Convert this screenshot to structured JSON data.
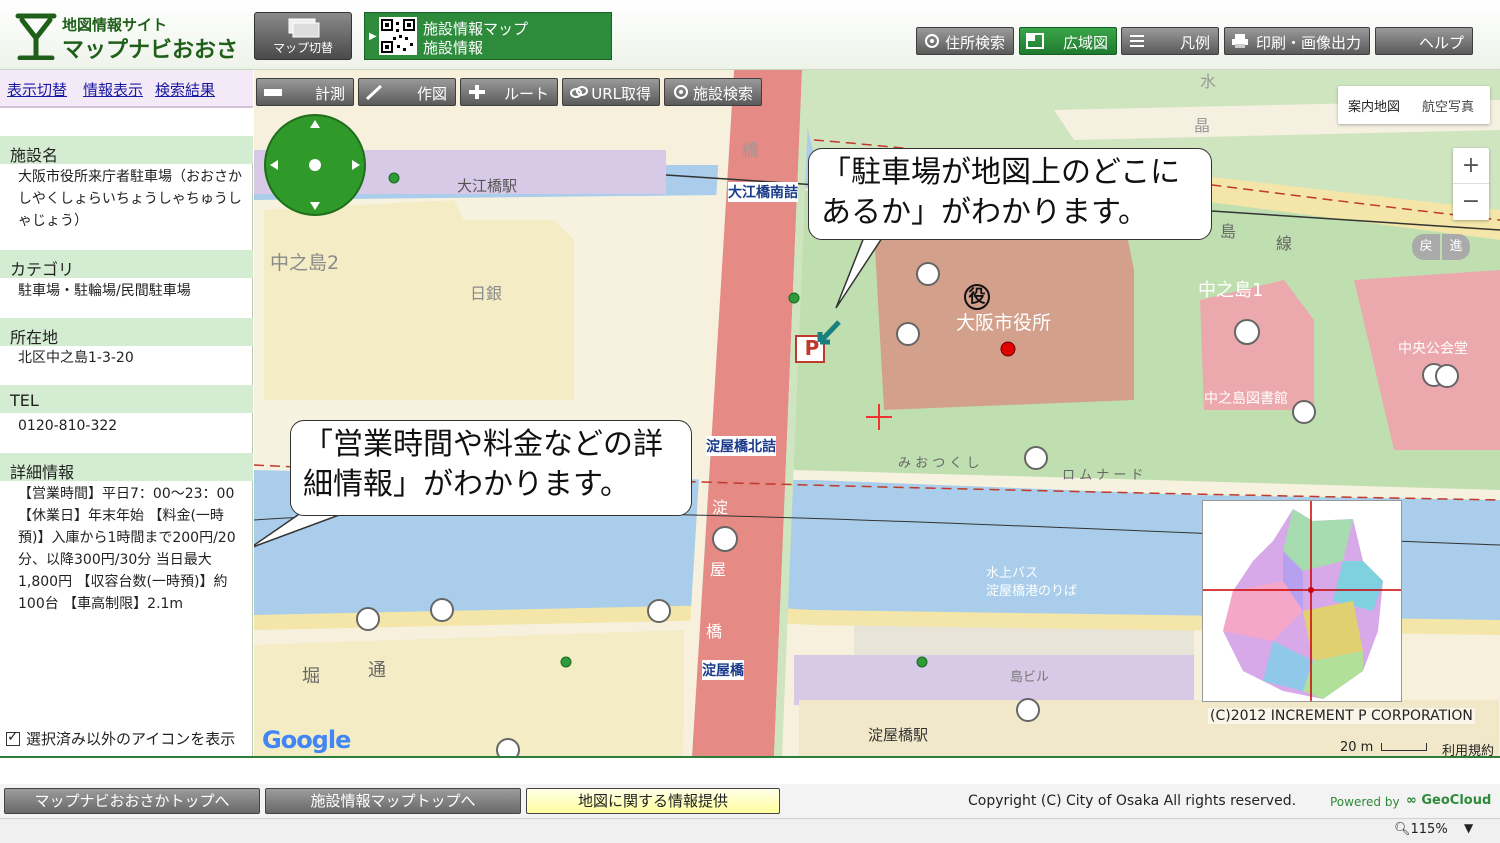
{
  "header": {
    "logo_line1": "地図情報サイト",
    "logo_line2": "マップナビおおさか",
    "switch_label": "マップ切替",
    "facility_line1": "施設情報マップ",
    "facility_line2": "施設情報",
    "buttons": [
      "住所検索",
      "広域図",
      "凡例",
      "印刷・画像出力",
      "ヘルプ"
    ]
  },
  "sidebar": {
    "tabs": [
      "表示切替",
      "情報表示",
      "検索結果"
    ],
    "sections": [
      {
        "heading": "施設名",
        "value": "大阪市役所来庁者駐車場（おおさかしやくしょらいちょうしゃちゅうしゃじょう）"
      },
      {
        "heading": "カテゴリ",
        "value": "駐車場・駐輪場/民間駐車場"
      },
      {
        "heading": "所在地",
        "value": "北区中之島1-3-20"
      },
      {
        "heading": "TEL",
        "value": "0120-810-322"
      },
      {
        "heading": "詳細情報",
        "value": "【営業時間】平日7：00～23：00 【休業日】年末年始 【料金(一時預)】入庫から1時間まで200円/20分、以降300円/30分 当日最大1,800円 【収容台数(一時預)】約100台 【車高制限】2.1m"
      }
    ],
    "checkbox_label": "選択済み以外のアイコンを表示"
  },
  "map": {
    "toolbar": [
      "計測",
      "作図",
      "ルート",
      "URL取得",
      "施設検索"
    ],
    "maptype": [
      "案内地図",
      "航空写真"
    ],
    "zoom_in": "+",
    "zoom_out": "−",
    "labels": {
      "oebashi_station": "大江橋駅",
      "nakanoshima2": "中之島2",
      "bank": "日銀",
      "oebashi_south": "大江橋南詰",
      "bridge": "橋",
      "osaka_city_hall": "大阪市役所",
      "city_hall_mark": "役",
      "nakanoshima1": "中之島1",
      "central_hall": "中央公会堂",
      "library": "中之島図書館",
      "island": "島",
      "line": "線",
      "mitsukushi": "み お つ く し",
      "promenade": "ロ ム ナ ー ド",
      "yodoyabashi_north": "淀屋橋北詰",
      "yodo": "淀",
      "ya": "屋",
      "hashi": "橋",
      "yodoyabashi": "淀屋橋",
      "yodoyabashi_station": "淀屋橋駅",
      "water_bus": "水上バス",
      "water_bus_pier": "淀屋橋港のりば",
      "hori": "堀",
      "dori": "通",
      "building": "島ビル",
      "north_char": "水",
      "north_char2": "晶",
      "back": "戻",
      "forward": "進"
    },
    "bubble_top": "「駐車場が地図上のどこにあるか」がわかります。",
    "bubble_left": "「営業時間や料金などの詳細情報」がわかります。",
    "copyright": "(C)2012 INCREMENT P CORPORATION",
    "scale": "20 m",
    "terms": "利用規約",
    "google": "Google",
    "parking_symbol": "P"
  },
  "footer": {
    "buttons": [
      "マップナビおおさかトップへ",
      "施設情報マップトップへ",
      "地図に関する情報提供"
    ],
    "copyright": "Copyright (C) City of Osaka All rights reserved.",
    "powered_by": "Powered by",
    "brand": "GeoCloud"
  },
  "statusbar": {
    "zoom": "115%"
  }
}
